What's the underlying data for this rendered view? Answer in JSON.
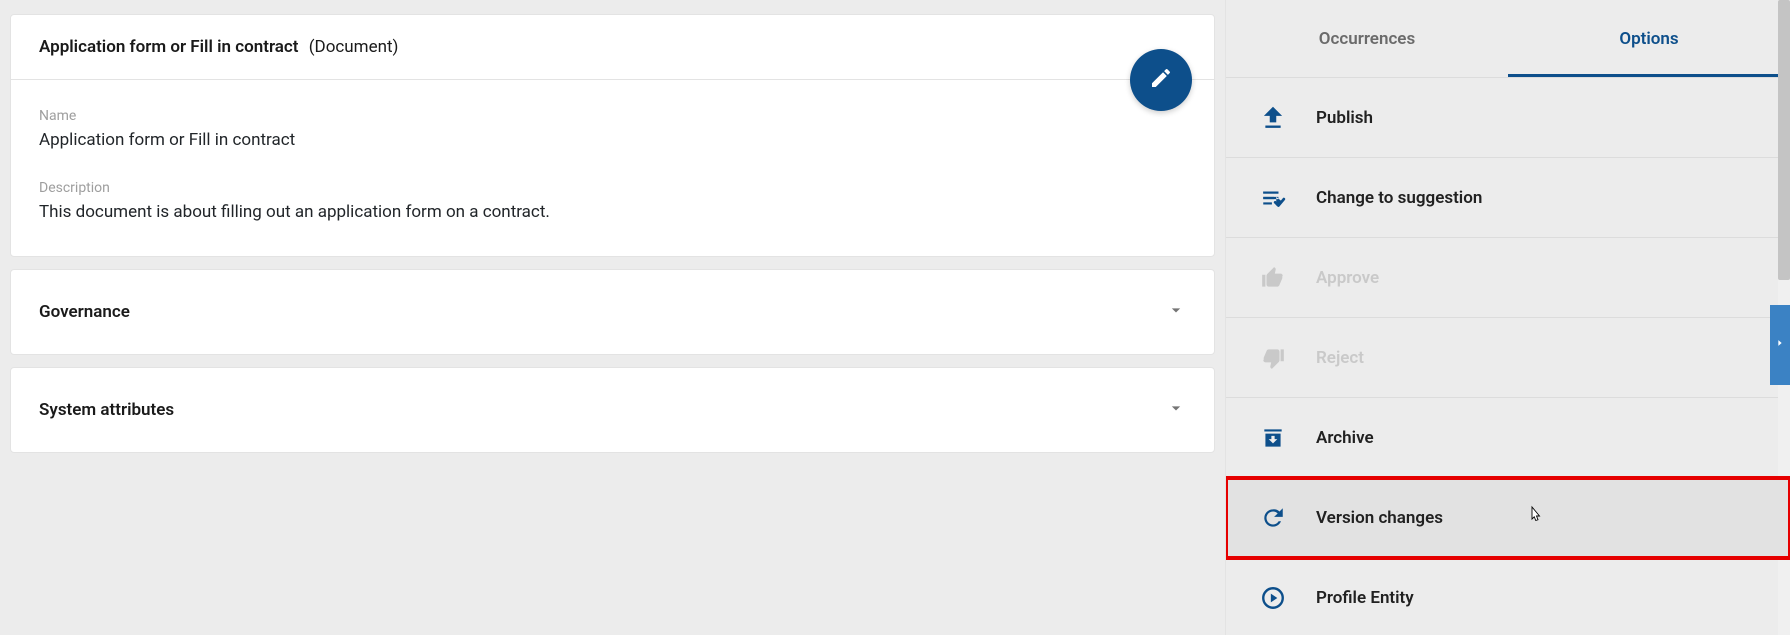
{
  "header": {
    "title": "Application form or Fill in contract",
    "type_label": "(Document)"
  },
  "fields": {
    "name_label": "Name",
    "name_value": "Application form or Fill in contract",
    "description_label": "Description",
    "description_value": "This document is about filling out an application form on a contract."
  },
  "accordions": {
    "governance": "Governance",
    "system_attributes": "System attributes"
  },
  "tabs": {
    "occurrences": "Occurrences",
    "options": "Options"
  },
  "options": [
    {
      "id": "publish",
      "label": "Publish",
      "enabled": true
    },
    {
      "id": "change_suggest",
      "label": "Change to suggestion",
      "enabled": true
    },
    {
      "id": "approve",
      "label": "Approve",
      "enabled": false
    },
    {
      "id": "reject",
      "label": "Reject",
      "enabled": false
    },
    {
      "id": "archive",
      "label": "Archive",
      "enabled": true
    },
    {
      "id": "version",
      "label": "Version changes",
      "enabled": true,
      "highlight": true
    },
    {
      "id": "profile",
      "label": "Profile Entity",
      "enabled": true
    }
  ]
}
